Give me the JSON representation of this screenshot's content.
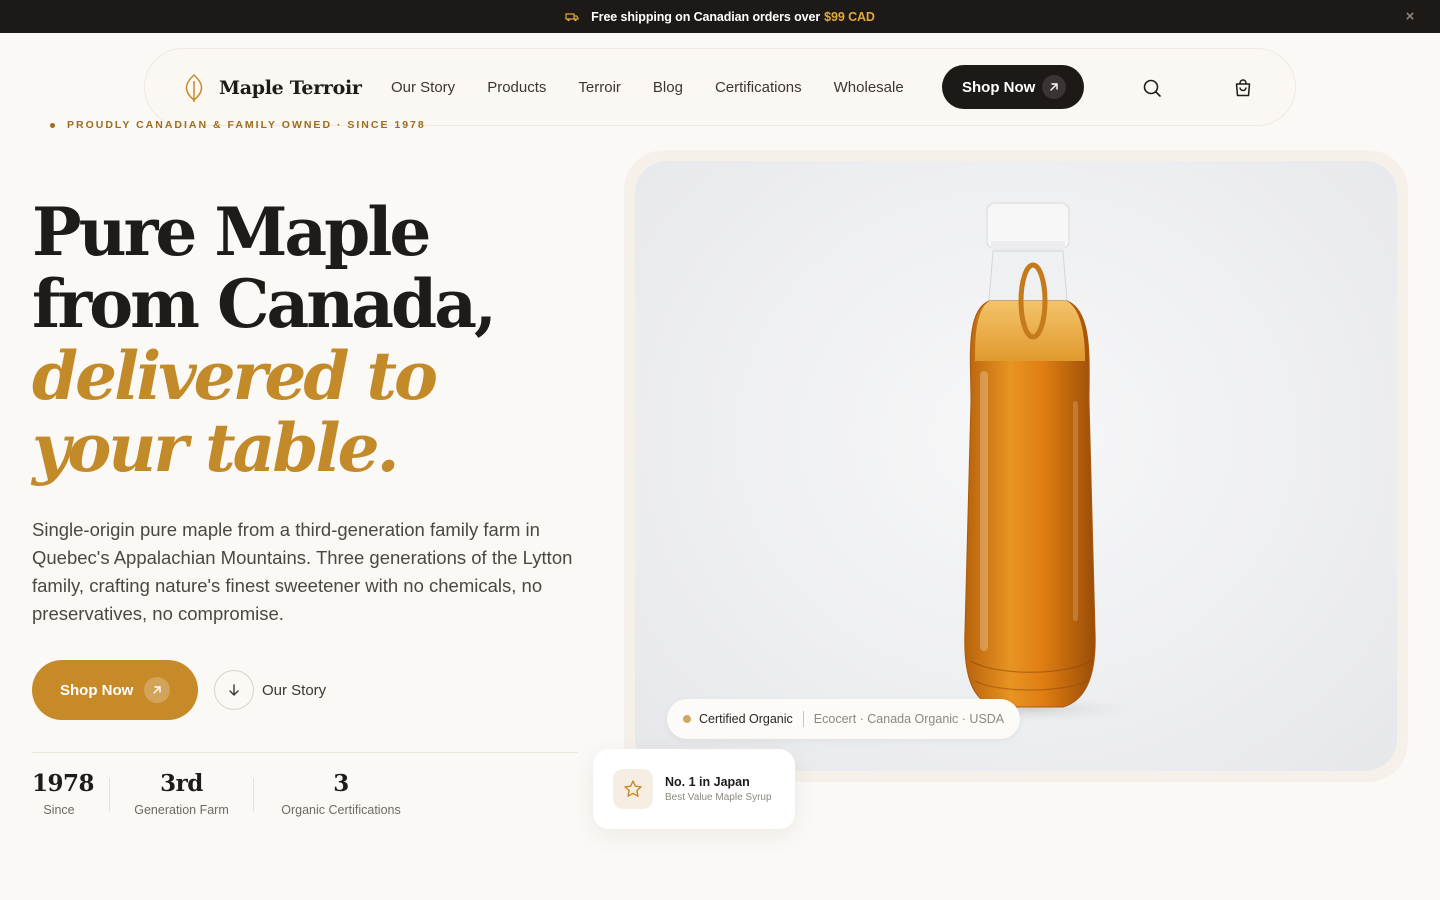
{
  "announcement": {
    "text": "Free shipping on Canadian orders over",
    "highlight": "$99 CAD",
    "close_label": "×",
    "truck_icon": "truck-icon"
  },
  "nav": {
    "brand": "Maple Terroir",
    "links": [
      "Our Story",
      "Products",
      "Terroir",
      "Blog",
      "Certifications",
      "Wholesale"
    ],
    "cta": "Shop Now",
    "icons": [
      "search-icon",
      "cart-icon"
    ]
  },
  "hero": {
    "tagline": "PROUDLY CANADIAN & FAMILY OWNED · SINCE 1978",
    "title_line1": "Pure Maple",
    "title_line2": "from Canada,",
    "title_line3": "delivered to",
    "title_line4": "your table.",
    "description": "Single-origin pure maple from a third-generation family farm in Quebec's Appalachian Mountains. Three generations of the Lytton family, crafting nature's finest sweetener with no chemicals, no preservatives, no compromise.",
    "primary_cta": "Shop Now",
    "secondary_cta": "Our Story"
  },
  "stats": [
    {
      "value": "1978",
      "label": "Since"
    },
    {
      "value": "3rd",
      "label": "Generation Farm"
    },
    {
      "value": "3",
      "label": "Organic Certifications"
    }
  ],
  "certification_badge": {
    "title": "Certified Organic",
    "bodies": "Ecocert · Canada Organic · USDA"
  },
  "award_card": {
    "title": "No. 1 in Japan",
    "subtitle": "Best Value Maple Syrup"
  },
  "colors": {
    "accent": "#c68a29",
    "dark": "#1c1917",
    "background": "#fbf9f6"
  }
}
